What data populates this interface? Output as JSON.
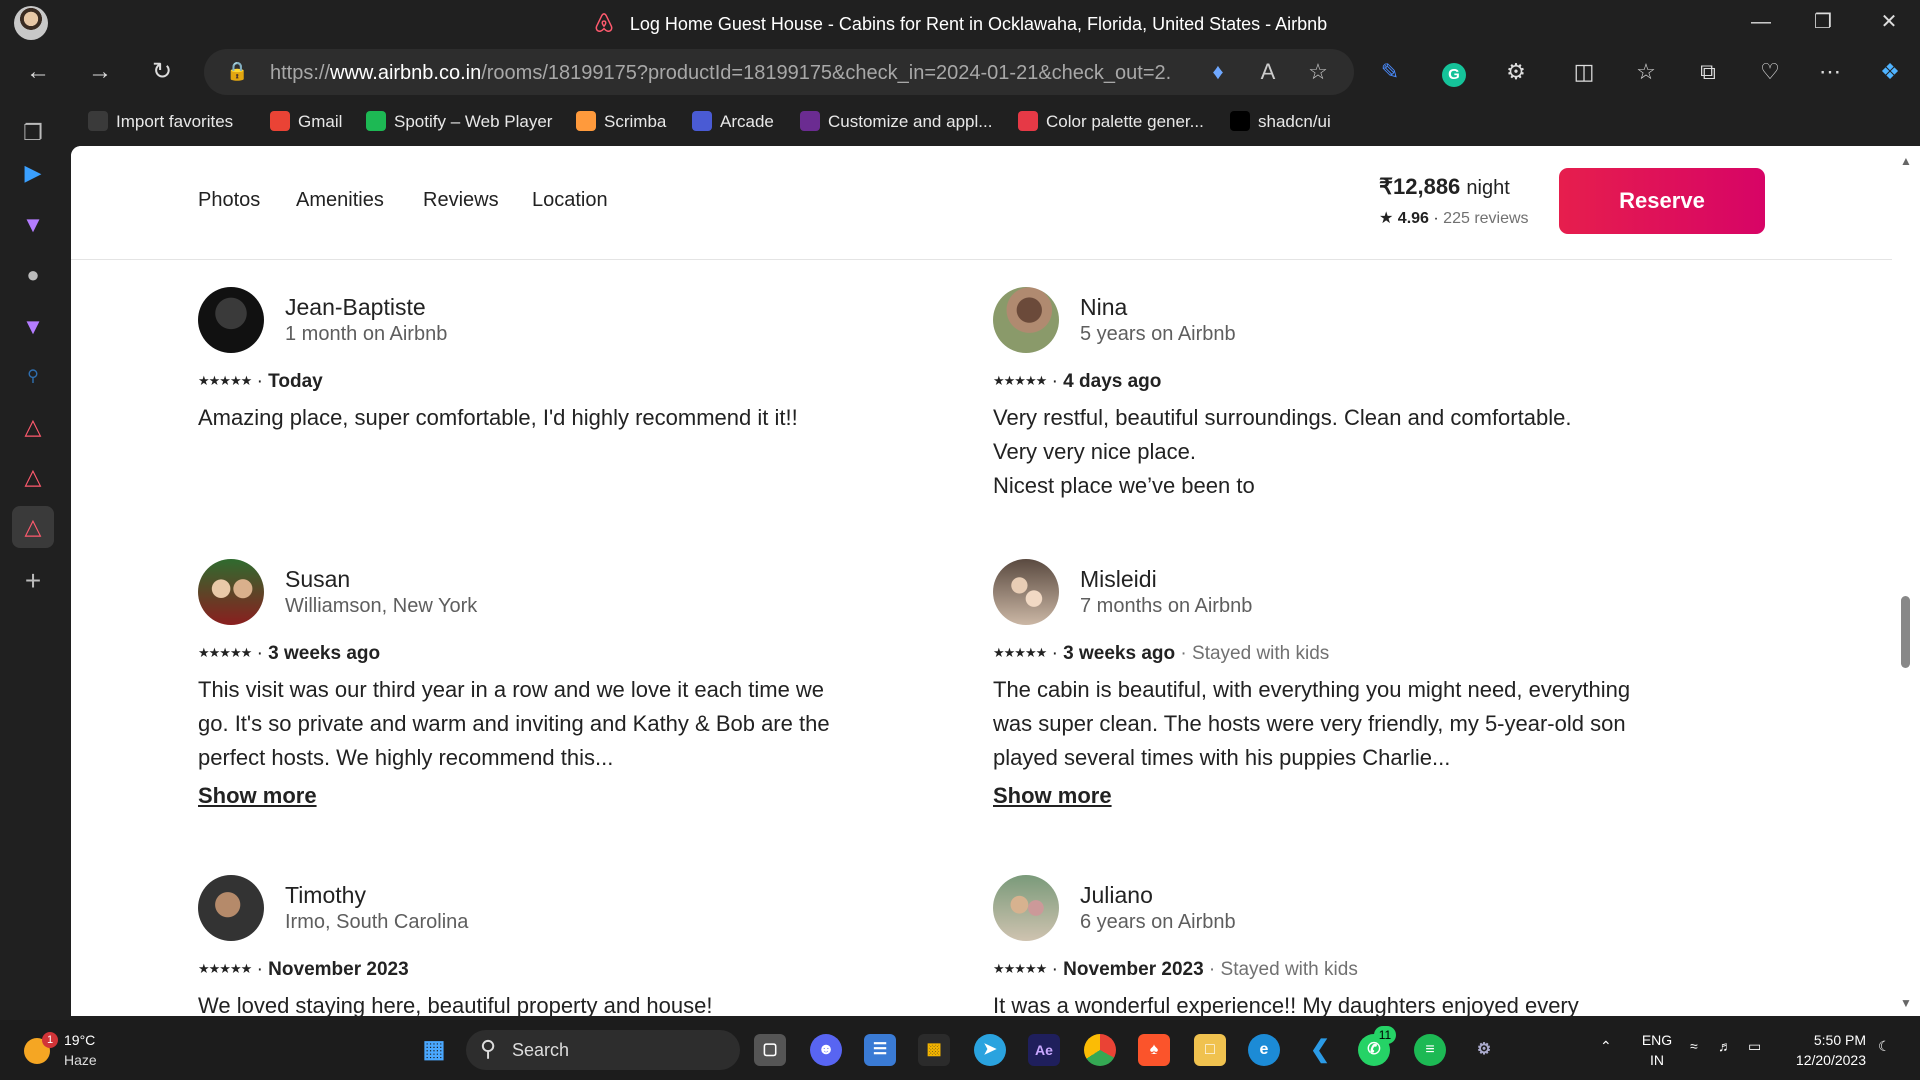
{
  "window": {
    "title": "Log Home Guest House - Cabins for Rent in Ocklawaha, Florida, United States - Airbnb"
  },
  "address_bar": {
    "url_prefix": "https://",
    "url_domain": "www.airbnb.co.in",
    "url_rest": "/rooms/18199175?productId=18199175&check_in=2024-01-21&check_out=2..."
  },
  "favorites": [
    {
      "label": "Import favorites",
      "icon": "folder-import-icon",
      "color": "#3a3a3a"
    },
    {
      "label": "Gmail",
      "icon": "gmail-icon",
      "color": "#ea4335"
    },
    {
      "label": "Spotify – Web Player",
      "icon": "spotify-icon",
      "color": "#1db954"
    },
    {
      "label": "Scrimba",
      "icon": "scrimba-icon",
      "color": "#ff9a3c"
    },
    {
      "label": "Arcade",
      "icon": "arcade-icon",
      "color": "#4a5bd4"
    },
    {
      "label": "Customize and appl...",
      "icon": "crown-icon",
      "color": "#6b2c91"
    },
    {
      "label": "Color palette gener...",
      "icon": "g-letter-icon",
      "color": "#e63946"
    },
    {
      "label": "shadcn/ui",
      "icon": "shadcn-icon",
      "color": "#000000"
    }
  ],
  "subnav": {
    "tabs": [
      "Photos",
      "Amenities",
      "Reviews",
      "Location"
    ],
    "price": "₹12,886",
    "price_unit": "night",
    "rating": "4.96",
    "reviews_count": "225 reviews",
    "reserve_label": "Reserve"
  },
  "reviews": [
    {
      "name": "Jean-Baptiste",
      "subtitle": "1 month on Airbnb",
      "rating": 5,
      "date": "Today",
      "extra": "",
      "text": "Amazing place, super comfortable, I'd highly recommend it it!!",
      "show_more": ""
    },
    {
      "name": "Nina",
      "subtitle": "5 years on Airbnb",
      "rating": 5,
      "date": "4 days ago",
      "extra": "",
      "text_lines": [
        "Very restful, beautiful surroundings. Clean and comfortable.",
        "Very very nice place.",
        "Nicest place we’ve been to"
      ],
      "show_more": ""
    },
    {
      "name": "Susan",
      "subtitle": "Williamson, New York",
      "rating": 5,
      "date": "3 weeks ago",
      "extra": "",
      "text": "This visit was our third year in a row and we love it each time we go. It's so private and warm and inviting and Kathy & Bob are the perfect hosts. We highly recommend this...",
      "show_more": "Show more"
    },
    {
      "name": "Misleidi",
      "subtitle": "7 months on Airbnb",
      "rating": 5,
      "date": "3 weeks ago",
      "extra": "Stayed with kids",
      "text": "The cabin is beautiful, with everything you might need, everything was super clean. The hosts were very friendly, my 5-year-old son played several times with his puppies Charlie...",
      "show_more": "Show more"
    },
    {
      "name": "Timothy",
      "subtitle": "Irmo, South Carolina",
      "rating": 5,
      "date": "November 2023",
      "extra": "",
      "text": "We loved staying here, beautiful property and house!",
      "show_more": ""
    },
    {
      "name": "Juliano",
      "subtitle": "6 years on Airbnb",
      "rating": 5,
      "date": "November 2023",
      "extra": "Stayed with kids",
      "text": "It was a wonderful experience!! My daughters enjoyed every",
      "show_more": ""
    }
  ],
  "stars_glyph": "★★★★★",
  "separator": "·",
  "taskbar": {
    "weather_temp": "19°C",
    "weather_cond": "Haze",
    "weather_badge": "1",
    "search_label": "Search",
    "whatsapp_badge": "11",
    "lang_top": "ENG",
    "lang_bottom": "IN",
    "time": "5:50 PM",
    "date": "12/20/2023"
  },
  "colors": {
    "accent": "#e61e4d",
    "chrome_bg": "#202020"
  }
}
